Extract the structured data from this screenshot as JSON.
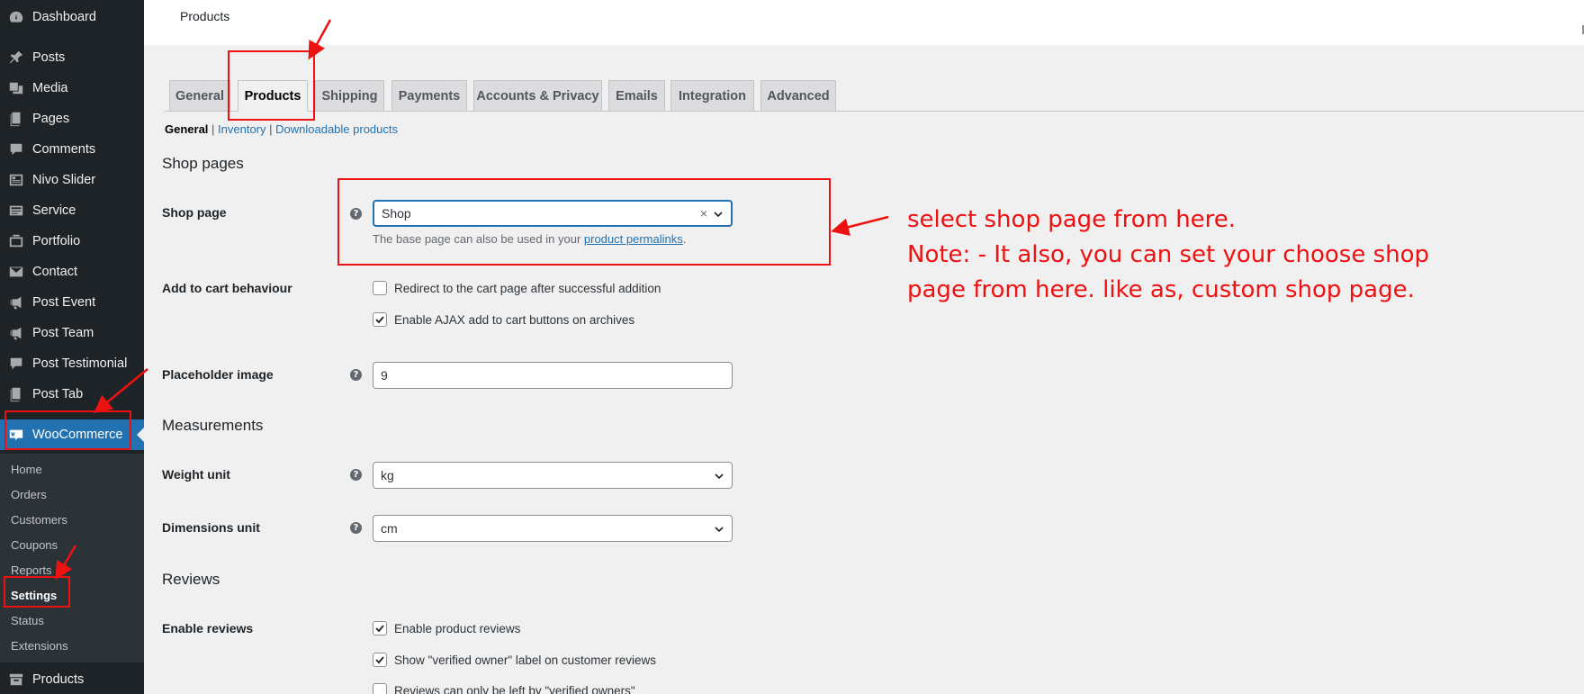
{
  "sidebar": {
    "items": [
      {
        "label": "Dashboard",
        "icon": "dashboard-icon"
      },
      {
        "label": "Posts",
        "icon": "pin-icon"
      },
      {
        "label": "Media",
        "icon": "media-icon"
      },
      {
        "label": "Pages",
        "icon": "pages-icon"
      },
      {
        "label": "Comments",
        "icon": "comment-icon"
      },
      {
        "label": "Nivo Slider",
        "icon": "slider-icon"
      },
      {
        "label": "Service",
        "icon": "service-icon"
      },
      {
        "label": "Portfolio",
        "icon": "portfolio-icon"
      },
      {
        "label": "Contact",
        "icon": "mail-icon"
      },
      {
        "label": "Post Event",
        "icon": "megaphone-icon"
      },
      {
        "label": "Post Team",
        "icon": "megaphone-icon"
      },
      {
        "label": "Post Testimonial",
        "icon": "comment-icon"
      },
      {
        "label": "Post Tab",
        "icon": "pages-icon"
      }
    ],
    "woocommerce": {
      "label": "WooCommerce",
      "icon": "woo-icon"
    },
    "submenu": [
      "Home",
      "Orders",
      "Customers",
      "Coupons",
      "Reports",
      "Settings",
      "Status",
      "Extensions"
    ],
    "products": {
      "label": "Products",
      "icon": "archive-icon"
    }
  },
  "topbar": {
    "title": "Products"
  },
  "tabs": [
    "General",
    "Products",
    "Shipping",
    "Payments",
    "Accounts & Privacy",
    "Emails",
    "Integration",
    "Advanced"
  ],
  "subnav": {
    "current": "General",
    "sep1": " | ",
    "inventory": "Inventory",
    "sep2": " | ",
    "downloadable": "Downloadable products"
  },
  "shop_pages": {
    "heading": "Shop pages",
    "shop_page_label": "Shop page",
    "shop_page_value": "Shop",
    "clear": "×",
    "desc_prefix": "The base page can also be used in your ",
    "desc_link": "product permalinks",
    "desc_suffix": ".",
    "add_to_cart_label": "Add to cart behaviour",
    "redirect_label": "Redirect to the cart page after successful addition",
    "redirect_checked": false,
    "ajax_label": "Enable AJAX add to cart buttons on archives",
    "ajax_checked": true,
    "placeholder_label": "Placeholder image",
    "placeholder_value": "9"
  },
  "measurements": {
    "heading": "Measurements",
    "weight_label": "Weight unit",
    "weight_value": "kg",
    "dimensions_label": "Dimensions unit",
    "dimensions_value": "cm"
  },
  "reviews": {
    "heading": "Reviews",
    "enable_label": "Enable reviews",
    "enable_product_reviews": "Enable product reviews",
    "verified_label": "Show \"verified owner\" label on customer reviews",
    "only_verified": "Reviews can only be left by \"verified owners\""
  },
  "annotation": {
    "line1": "select shop page from here.",
    "line2": "Note: - It also, you can set your choose shop",
    "line3": "page from here. like as, custom shop page."
  },
  "colors": {
    "accent": "#2271b1",
    "sidebar": "#1d2327",
    "annotation": "#ee1111"
  }
}
